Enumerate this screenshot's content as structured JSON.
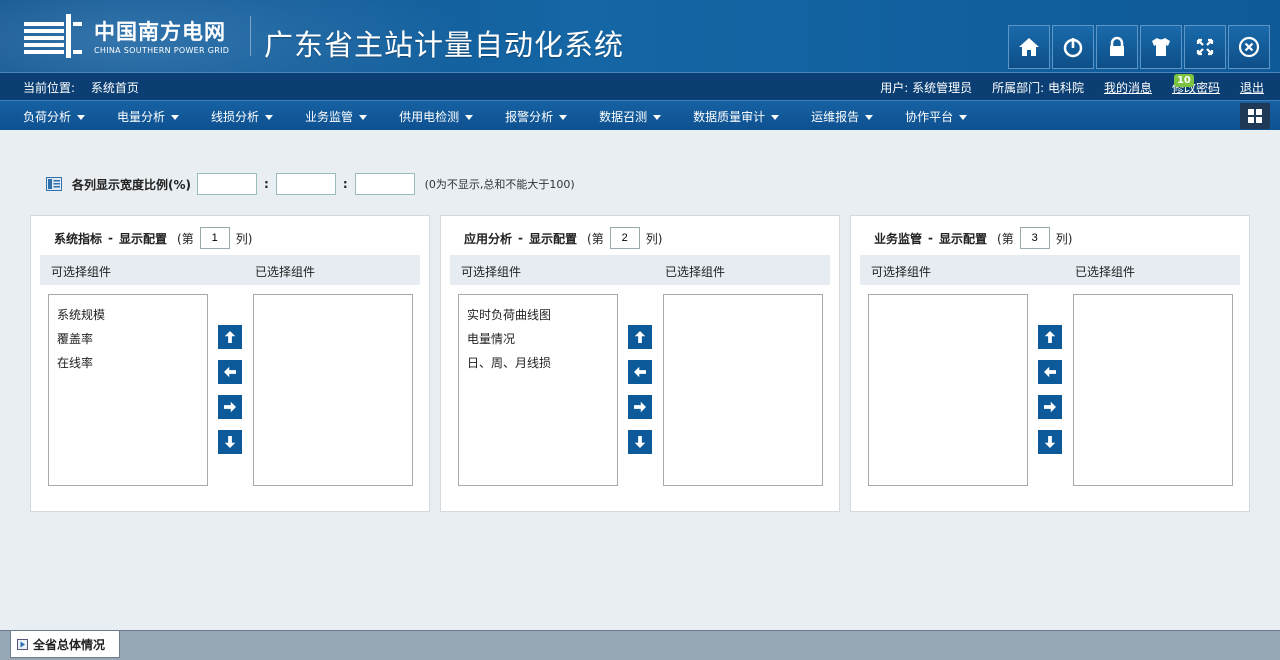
{
  "header": {
    "logo_cn": "中国南方电网",
    "logo_en": "CHINA SOUTHERN POWER GRID",
    "system_title": "广东省主站计量自动化系统",
    "tool_buttons": [
      {
        "icon": "home-icon"
      },
      {
        "icon": "power-icon"
      },
      {
        "icon": "lock-icon"
      },
      {
        "icon": "shirt-icon"
      },
      {
        "icon": "fullscreen-icon"
      },
      {
        "icon": "close-icon"
      }
    ]
  },
  "infobar": {
    "location_label": "当前位置:",
    "location_value": "系统首页",
    "user": "用户: 系统管理员",
    "dept": "所属部门: 电科院",
    "messages": "我的消息",
    "message_count": "10",
    "change_password": "修改密码",
    "logout": "退出"
  },
  "menu": {
    "items": [
      {
        "label": "负荷分析"
      },
      {
        "label": "电量分析"
      },
      {
        "label": "线损分析"
      },
      {
        "label": "业务监管"
      },
      {
        "label": "供用电检测"
      },
      {
        "label": "报警分析"
      },
      {
        "label": "数据召测"
      },
      {
        "label": "数据质量审计"
      },
      {
        "label": "运维报告"
      },
      {
        "label": "协作平台"
      }
    ]
  },
  "ratio": {
    "label": "各列显示宽度比例(%)",
    "colon": ":",
    "hint": "(0为不显示,总和不能大于100)"
  },
  "panels": [
    {
      "name": "系统指标",
      "sep": "-",
      "config": "显示配置",
      "col_prefix": "(第",
      "col_value": "1",
      "col_suffix": "列)",
      "available_header": "可选择组件",
      "selected_header": "已选择组件",
      "available": [
        "系统规模",
        "覆盖率",
        "在线率"
      ],
      "selected": []
    },
    {
      "name": "应用分析",
      "sep": "-",
      "config": "显示配置",
      "col_prefix": "(第",
      "col_value": "2",
      "col_suffix": "列)",
      "available_header": "可选择组件",
      "selected_header": "已选择组件",
      "available": [
        "实时负荷曲线图",
        "电量情况",
        "日、周、月线损"
      ],
      "selected": []
    },
    {
      "name": "业务监管",
      "sep": "-",
      "config": "显示配置",
      "col_prefix": "(第",
      "col_value": "3",
      "col_suffix": "列)",
      "available_header": "可选择组件",
      "selected_header": "已选择组件",
      "available": [],
      "selected": []
    }
  ],
  "bottom": {
    "tab_label": "全省总体情况"
  },
  "colors": {
    "header_blue": "#0c4d86",
    "menu_blue": "#0e5191",
    "arrow_blue": "#0d5a9a",
    "badge_green": "#7cc342"
  }
}
